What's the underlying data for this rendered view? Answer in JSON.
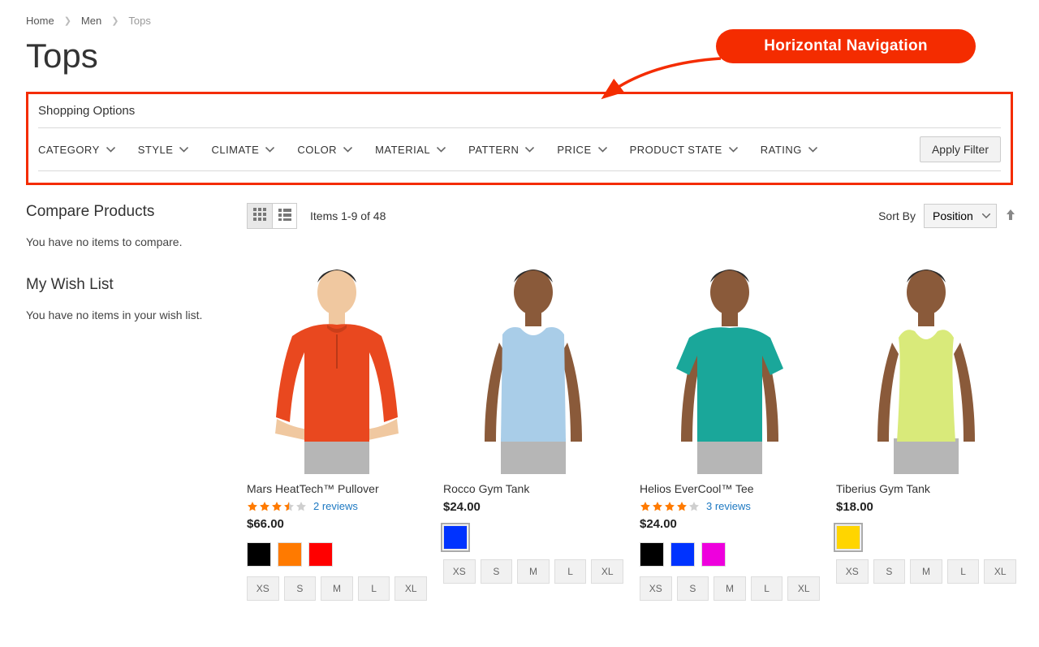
{
  "breadcrumb": {
    "items": [
      "Home",
      "Men",
      "Tops"
    ]
  },
  "page_title": "Tops",
  "callout": {
    "label": "Horizontal Navigation"
  },
  "shopping_options": {
    "title": "Shopping Options",
    "filters": [
      "CATEGORY",
      "STYLE",
      "CLIMATE",
      "COLOR",
      "MATERIAL",
      "PATTERN",
      "PRICE",
      "PRODUCT STATE",
      "RATING"
    ],
    "apply_label": "Apply Filter"
  },
  "sidebar": {
    "compare_title": "Compare Products",
    "compare_empty": "You have no items to compare.",
    "wishlist_title": "My Wish List",
    "wishlist_empty": "You have no items in your wish list."
  },
  "toolbar": {
    "count_text": "Items 1-9 of 48",
    "sort_label": "Sort By",
    "sort_value": "Position"
  },
  "sizes": [
    "XS",
    "S",
    "M",
    "L",
    "XL"
  ],
  "products": [
    {
      "name": "Mars HeatTech™ Pullover",
      "rating": 3.5,
      "reviews": "2 reviews",
      "price": "$66.00",
      "colors": [
        "#000000",
        "#ff7a00",
        "#ff0000"
      ],
      "shirt_color": "#e9481f",
      "shirt_type": "longsleeve",
      "skin": "#f0c8a0"
    },
    {
      "name": "Rocco Gym Tank",
      "rating": 0,
      "reviews": "",
      "price": "$24.00",
      "colors": [
        "#0033ff"
      ],
      "shirt_color": "#a9cde8",
      "shirt_type": "sleeveless",
      "skin": "#8a5a3a"
    },
    {
      "name": "Helios EverCool™ Tee",
      "rating": 4,
      "reviews": "3 reviews",
      "price": "$24.00",
      "colors": [
        "#000000",
        "#0033ff",
        "#ee00dd"
      ],
      "shirt_color": "#1aa79a",
      "shirt_type": "tee",
      "skin": "#8a5a3a"
    },
    {
      "name": "Tiberius Gym Tank",
      "rating": 0,
      "reviews": "",
      "price": "$18.00",
      "colors": [
        "#ffd500"
      ],
      "shirt_color": "#d9ea7a",
      "shirt_type": "tank",
      "skin": "#8a5a3a"
    }
  ]
}
